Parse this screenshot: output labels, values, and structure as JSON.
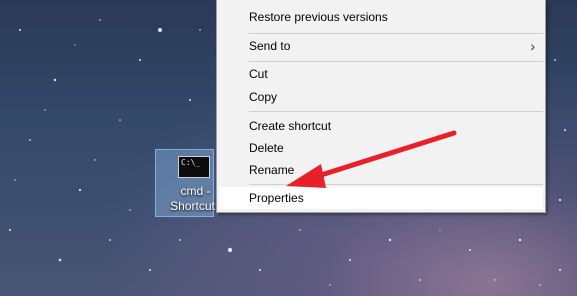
{
  "desktop_icon": {
    "glyph": "C:\\_",
    "label_line1": "cmd -",
    "label_line2": "Shortcut"
  },
  "context_menu": {
    "restore": "Restore previous versions",
    "send_to": "Send to",
    "cut": "Cut",
    "copy": "Copy",
    "create_shortcut": "Create shortcut",
    "delete": "Delete",
    "rename": "Rename",
    "properties": "Properties",
    "submenu_arrow": "›"
  },
  "annotation": {
    "arrow_color": "#e8202a"
  }
}
